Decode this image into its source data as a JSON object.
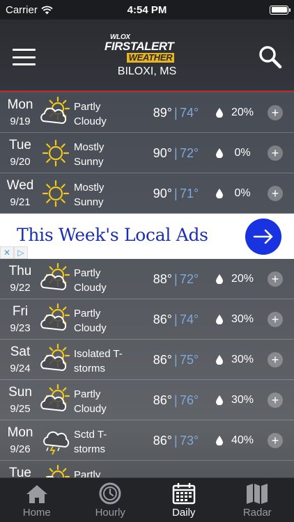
{
  "status_bar": {
    "carrier": "Carrier",
    "time": "4:54 PM"
  },
  "header": {
    "logo_station": "WLOX",
    "logo_first": "FIRST",
    "logo_alert": "ALERT",
    "logo_weather": "WEATHER",
    "location": "BILOXI, MS"
  },
  "forecast": [
    {
      "day": "Mon",
      "date": "9/19",
      "icon": "partly-cloudy-icon",
      "cond1": "Partly",
      "cond2": "Cloudy",
      "hi": "89°",
      "lo": "74°",
      "precip": "20%"
    },
    {
      "day": "Tue",
      "date": "9/20",
      "icon": "sunny-icon",
      "cond1": "Mostly",
      "cond2": "Sunny",
      "hi": "90°",
      "lo": "72°",
      "precip": "0%"
    },
    {
      "day": "Wed",
      "date": "9/21",
      "icon": "sunny-icon",
      "cond1": "Mostly",
      "cond2": "Sunny",
      "hi": "90°",
      "lo": "71°",
      "precip": "0%"
    },
    {
      "day": "Thu",
      "date": "9/22",
      "icon": "partly-cloudy-icon",
      "cond1": "Partly",
      "cond2": "Cloudy",
      "hi": "88°",
      "lo": "72°",
      "precip": "20%"
    },
    {
      "day": "Fri",
      "date": "9/23",
      "icon": "partly-cloudy-icon",
      "cond1": "Partly",
      "cond2": "Cloudy",
      "hi": "86°",
      "lo": "74°",
      "precip": "30%"
    },
    {
      "day": "Sat",
      "date": "9/24",
      "icon": "partly-cloudy-icon",
      "cond1": "Isolated T-",
      "cond2": "storms",
      "hi": "86°",
      "lo": "75°",
      "precip": "30%"
    },
    {
      "day": "Sun",
      "date": "9/25",
      "icon": "partly-cloudy-icon",
      "cond1": "Partly",
      "cond2": "Cloudy",
      "hi": "86°",
      "lo": "76°",
      "precip": "30%"
    },
    {
      "day": "Mon",
      "date": "9/26",
      "icon": "thunderstorm-icon",
      "cond1": "Sctd T-",
      "cond2": "storms",
      "hi": "86°",
      "lo": "73°",
      "precip": "40%"
    },
    {
      "day": "Tue",
      "date": "",
      "icon": "partly-cloudy-icon",
      "cond1": "Partly",
      "cond2": "",
      "hi": "",
      "lo": "",
      "precip": ""
    }
  ],
  "separator": "|",
  "ad": {
    "text": "This Week's Local Ads",
    "choices_x": "✕",
    "choices_play": "▷"
  },
  "tabs": [
    {
      "label": "Home",
      "icon": "home-icon"
    },
    {
      "label": "Hourly",
      "icon": "clock-icon"
    },
    {
      "label": "Daily",
      "icon": "calendar-icon",
      "active": true
    },
    {
      "label": "Radar",
      "icon": "map-icon"
    }
  ],
  "colors": {
    "accent_red": "#c0272d",
    "low_temp": "#7fa9d9",
    "sun": "#f2c81d",
    "ad_blue": "#1a33e0"
  }
}
